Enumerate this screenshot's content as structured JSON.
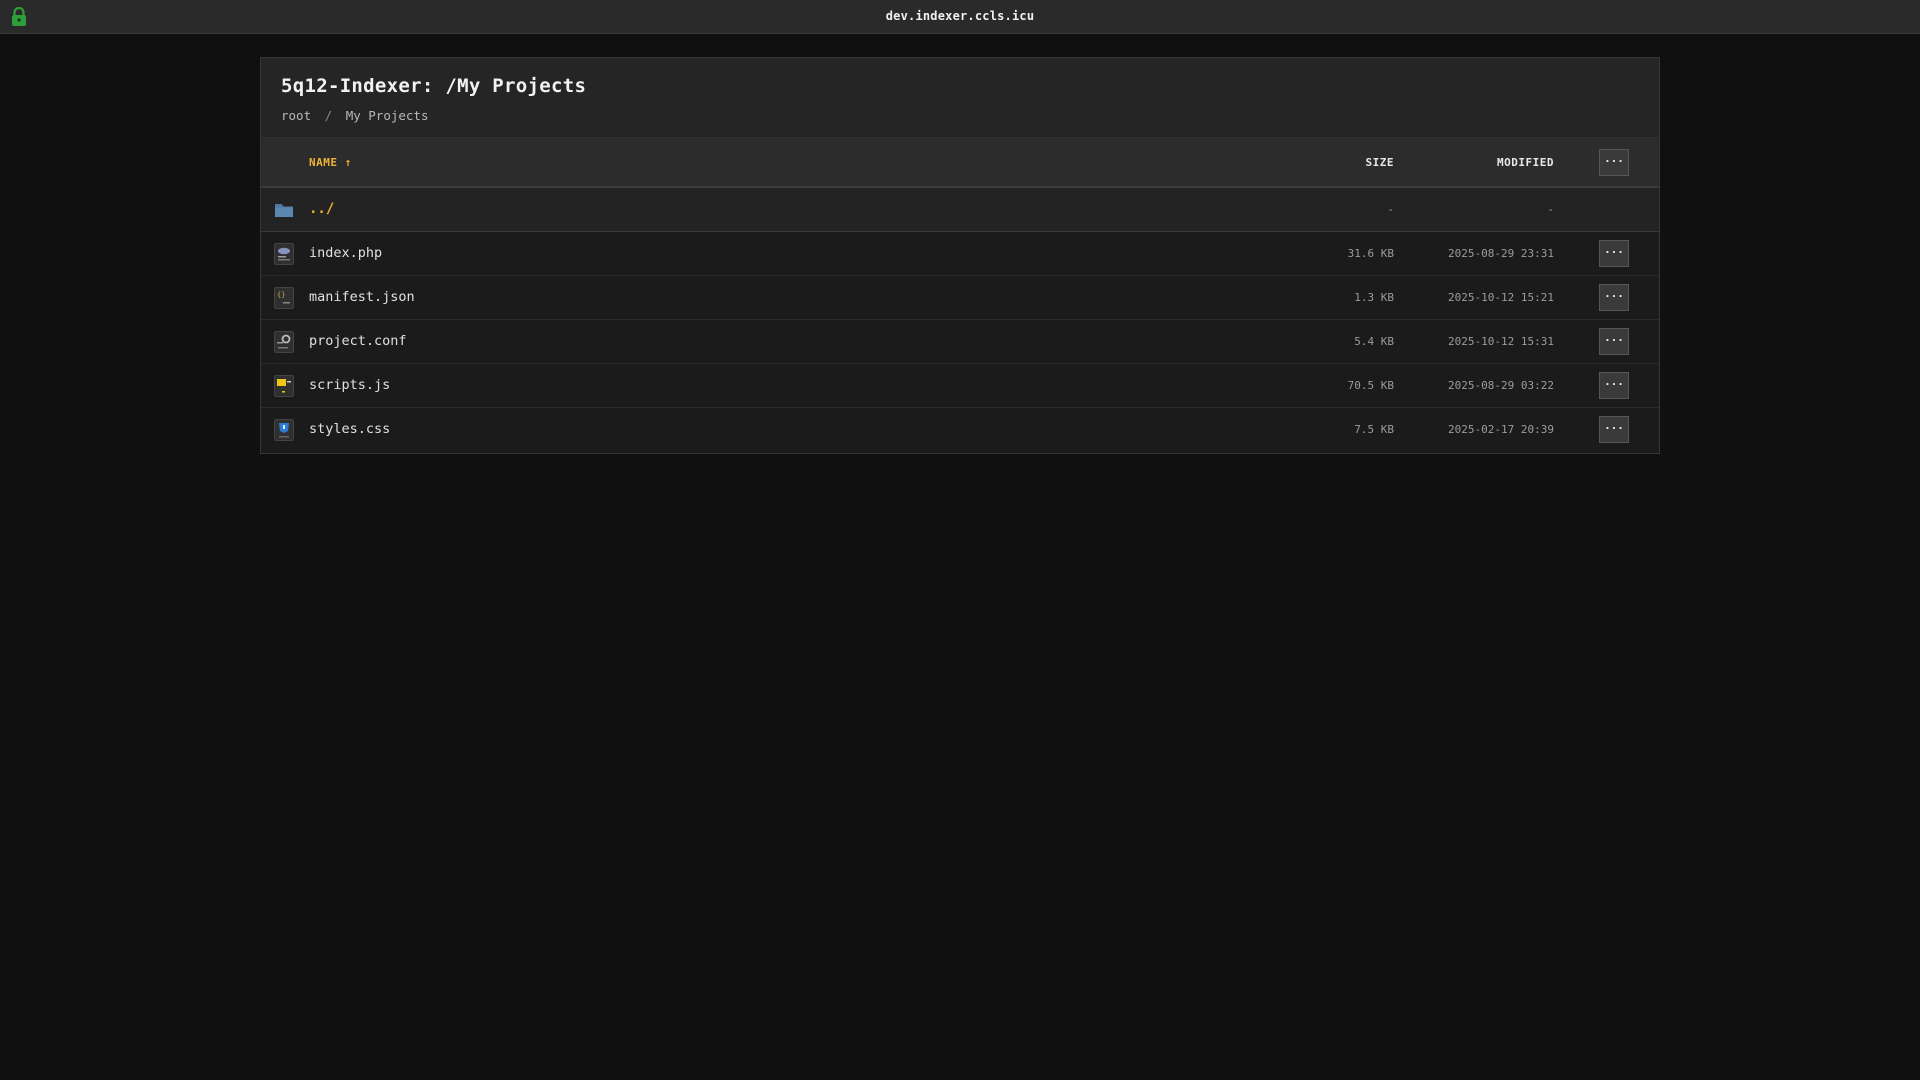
{
  "topbar": {
    "host": "dev.indexer.ccls.icu"
  },
  "header": {
    "title": "5q12-Indexer: /My Projects",
    "breadcrumb": [
      "root",
      "My Projects"
    ],
    "breadcrumb_sep": "/"
  },
  "table": {
    "columns": {
      "name": "NAME ↑",
      "size": "SIZE",
      "modified": "MODIFIED"
    },
    "menu_label": "···",
    "parent": {
      "name": "../",
      "size": "-",
      "modified": "-"
    },
    "rows": [
      {
        "name": "index.php",
        "size": "31.6 KB",
        "modified": "2025-08-29 23:31",
        "icon": "php-file-icon"
      },
      {
        "name": "manifest.json",
        "size": "1.3 KB",
        "modified": "2025-10-12 15:21",
        "icon": "json-file-icon"
      },
      {
        "name": "project.conf",
        "size": "5.4 KB",
        "modified": "2025-10-12 15:31",
        "icon": "config-file-icon"
      },
      {
        "name": "scripts.js",
        "size": "70.5 KB",
        "modified": "2025-08-29 03:22",
        "icon": "js-file-icon"
      },
      {
        "name": "styles.css",
        "size": "7.5 KB",
        "modified": "2025-02-17 20:39",
        "icon": "css-file-icon"
      }
    ]
  },
  "colors": {
    "accent": "#f0b232",
    "lock": "#2e9e3a",
    "folder": "#5b88b0"
  }
}
